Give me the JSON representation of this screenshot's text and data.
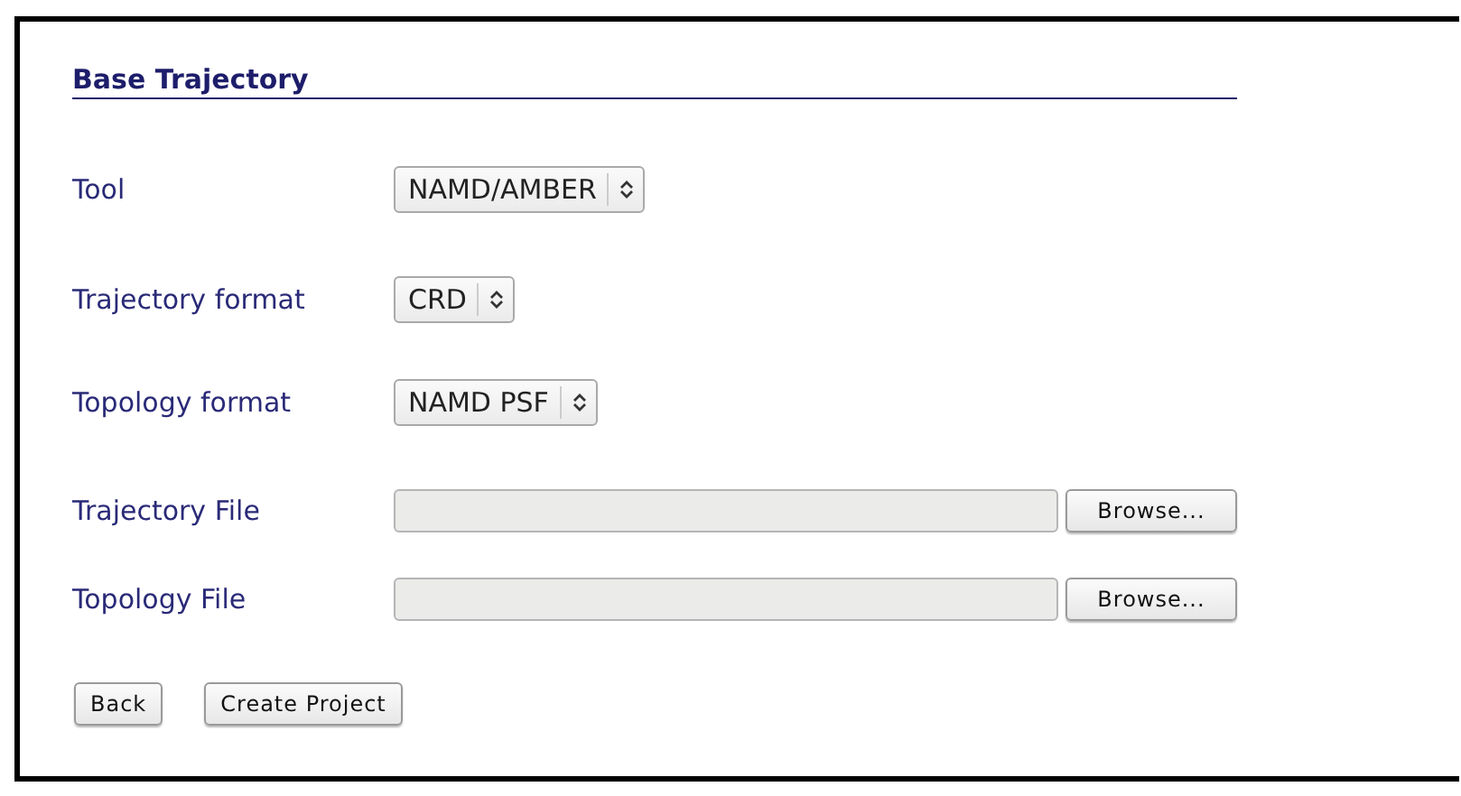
{
  "heading": "Base Trajectory",
  "fields": [
    {
      "kind": "select",
      "label": "Tool",
      "value": "NAMD/AMBER"
    },
    {
      "kind": "select",
      "label": "Trajectory format",
      "value": "CRD"
    },
    {
      "kind": "select",
      "label": "Topology format",
      "value": "NAMD PSF"
    },
    {
      "kind": "file",
      "label": "Trajectory File",
      "button": "Browse..."
    },
    {
      "kind": "file",
      "label": "Topology File",
      "button": "Browse..."
    }
  ],
  "buttons": [
    "Back",
    "Create Project"
  ]
}
